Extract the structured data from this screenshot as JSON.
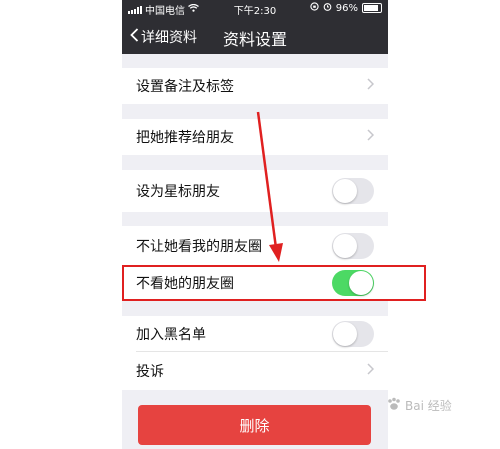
{
  "status_bar": {
    "carrier": "中国电信",
    "time": "下午2:30",
    "battery": "96%"
  },
  "nav": {
    "back_label": "详细资料",
    "title": "资料设置"
  },
  "cells": {
    "remark": {
      "label": "设置备注及标签"
    },
    "recommend": {
      "label": "把她推荐给朋友"
    },
    "star": {
      "label": "设为星标朋友",
      "on": false
    },
    "hide_my_moments": {
      "label": "不让她看我的朋友圈",
      "on": false
    },
    "hide_her_moments": {
      "label": "不看她的朋友圈",
      "on": true
    },
    "blacklist": {
      "label": "加入黑名单",
      "on": false
    },
    "report": {
      "label": "投诉"
    }
  },
  "delete_button": {
    "label": "删除"
  },
  "watermark": {
    "text": "Bai  经验"
  },
  "colors": {
    "nav_bg": "#2e2e33",
    "toggle_on": "#4cd964",
    "delete_red": "#e64340",
    "annotation_red": "#e02020"
  }
}
